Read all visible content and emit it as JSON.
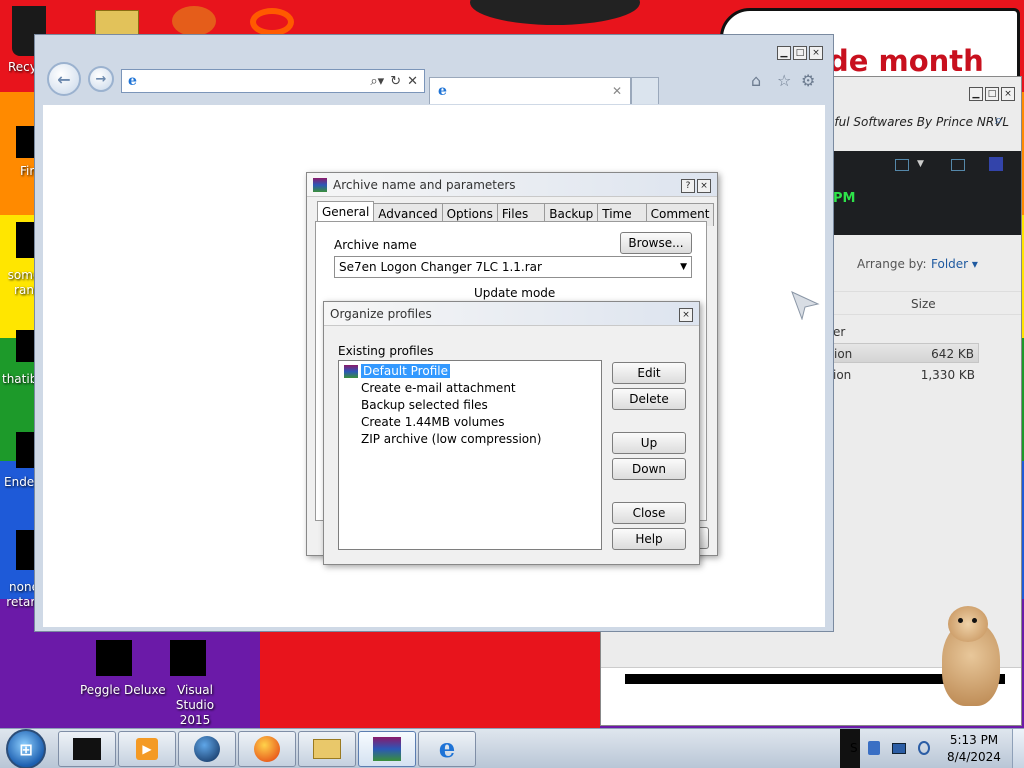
{
  "desktop": {
    "icons_left": [
      {
        "label": "Recy"
      },
      {
        "label": "Fir"
      },
      {
        "label": "some ran"
      },
      {
        "label": "thatib"
      },
      {
        "label": "Ender"
      },
      {
        "label": "none retarc"
      }
    ],
    "icons_bottom": [
      {
        "label": "Peggle Deluxe"
      },
      {
        "label": "Visual Studio 2015"
      }
    ],
    "promo_text": "de month"
  },
  "explorer": {
    "breadcrumb": "eful Softwares By Prince NRVL",
    "clock_fragment": "PM",
    "arrange_by_label": "Arrange by:",
    "arrange_by_value": "Folder",
    "column_size": "Size",
    "type_header": "er",
    "rows": [
      {
        "type": "ion",
        "size": "642 KB"
      },
      {
        "type": "ion",
        "size": "1,330 KB"
      }
    ]
  },
  "ie": {
    "address_value": "",
    "tab_title": ""
  },
  "archive_dialog": {
    "title": "Archive name and parameters",
    "tabs": [
      "General",
      "Advanced",
      "Options",
      "Files",
      "Backup",
      "Time",
      "Comment"
    ],
    "active_tab": "General",
    "archive_name_label": "Archive name",
    "browse_label": "Browse...",
    "archive_name_value": "Se7en Logon Changer 7LC 1.1.rar",
    "update_mode_label": "Update mode"
  },
  "profiles_dialog": {
    "title": "Organize profiles",
    "existing_label": "Existing profiles",
    "profiles": [
      "Default Profile",
      "Create e-mail attachment",
      "Backup selected files",
      "Create 1.44MB volumes",
      "ZIP archive (low compression)"
    ],
    "selected_index": 0,
    "buttons": {
      "edit": "Edit",
      "delete": "Delete",
      "up": "Up",
      "down": "Down",
      "close": "Close",
      "help": "Help"
    }
  },
  "taskbar": {
    "time": "5:13 PM",
    "date": "8/4/2024",
    "tray_fragment": "S"
  },
  "colors": {
    "accent": "#3399ff",
    "promo": "#c8101e",
    "green_text": "#2ee34a"
  }
}
